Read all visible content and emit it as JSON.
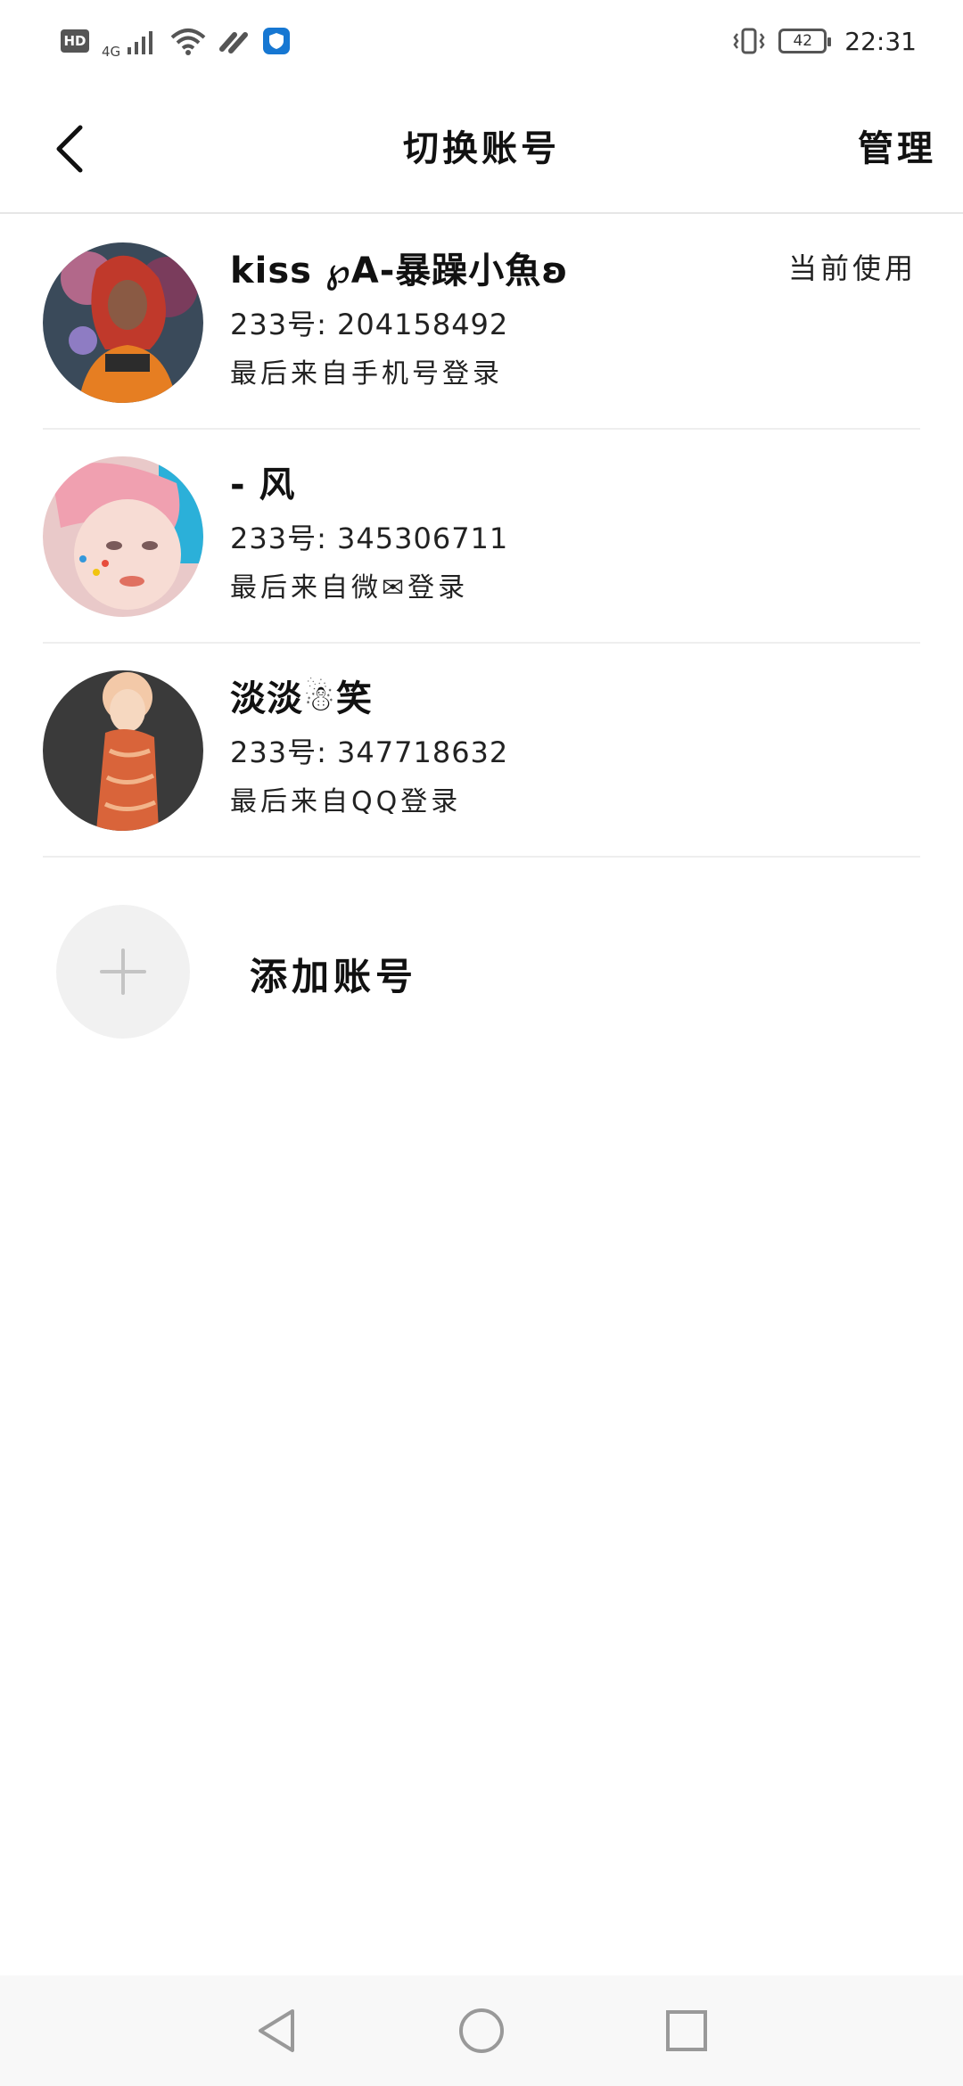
{
  "status_bar": {
    "hd": "HD",
    "network": "4G",
    "battery": "42",
    "time": "22:31"
  },
  "header": {
    "title": "切换账号",
    "manage_label": "管理"
  },
  "accounts": [
    {
      "name": "kiss ℘A-暴躁小魚ʚ",
      "id_line": "233号: 204158492",
      "last_login": "最后来自手机号登录",
      "current_label": "当前使用"
    },
    {
      "name": "- 风",
      "id_line": "233号: 345306711",
      "last_login": "最后来自微✉登录"
    },
    {
      "name": "淡淡☃笑",
      "id_line": "233号: 347718632",
      "last_login": "最后来自QQ登录"
    }
  ],
  "add_account": {
    "label": "添加账号"
  },
  "colors": {
    "divider": "#e6e6e6",
    "add_circle": "#f1f1f1",
    "shield_accent": "#1677d2"
  },
  "icons": [
    "back-arrow-icon",
    "plus-icon",
    "nav-back-icon",
    "nav-home-icon",
    "nav-recent-icon",
    "wifi-icon",
    "signal-icon",
    "vibrate-icon"
  ]
}
